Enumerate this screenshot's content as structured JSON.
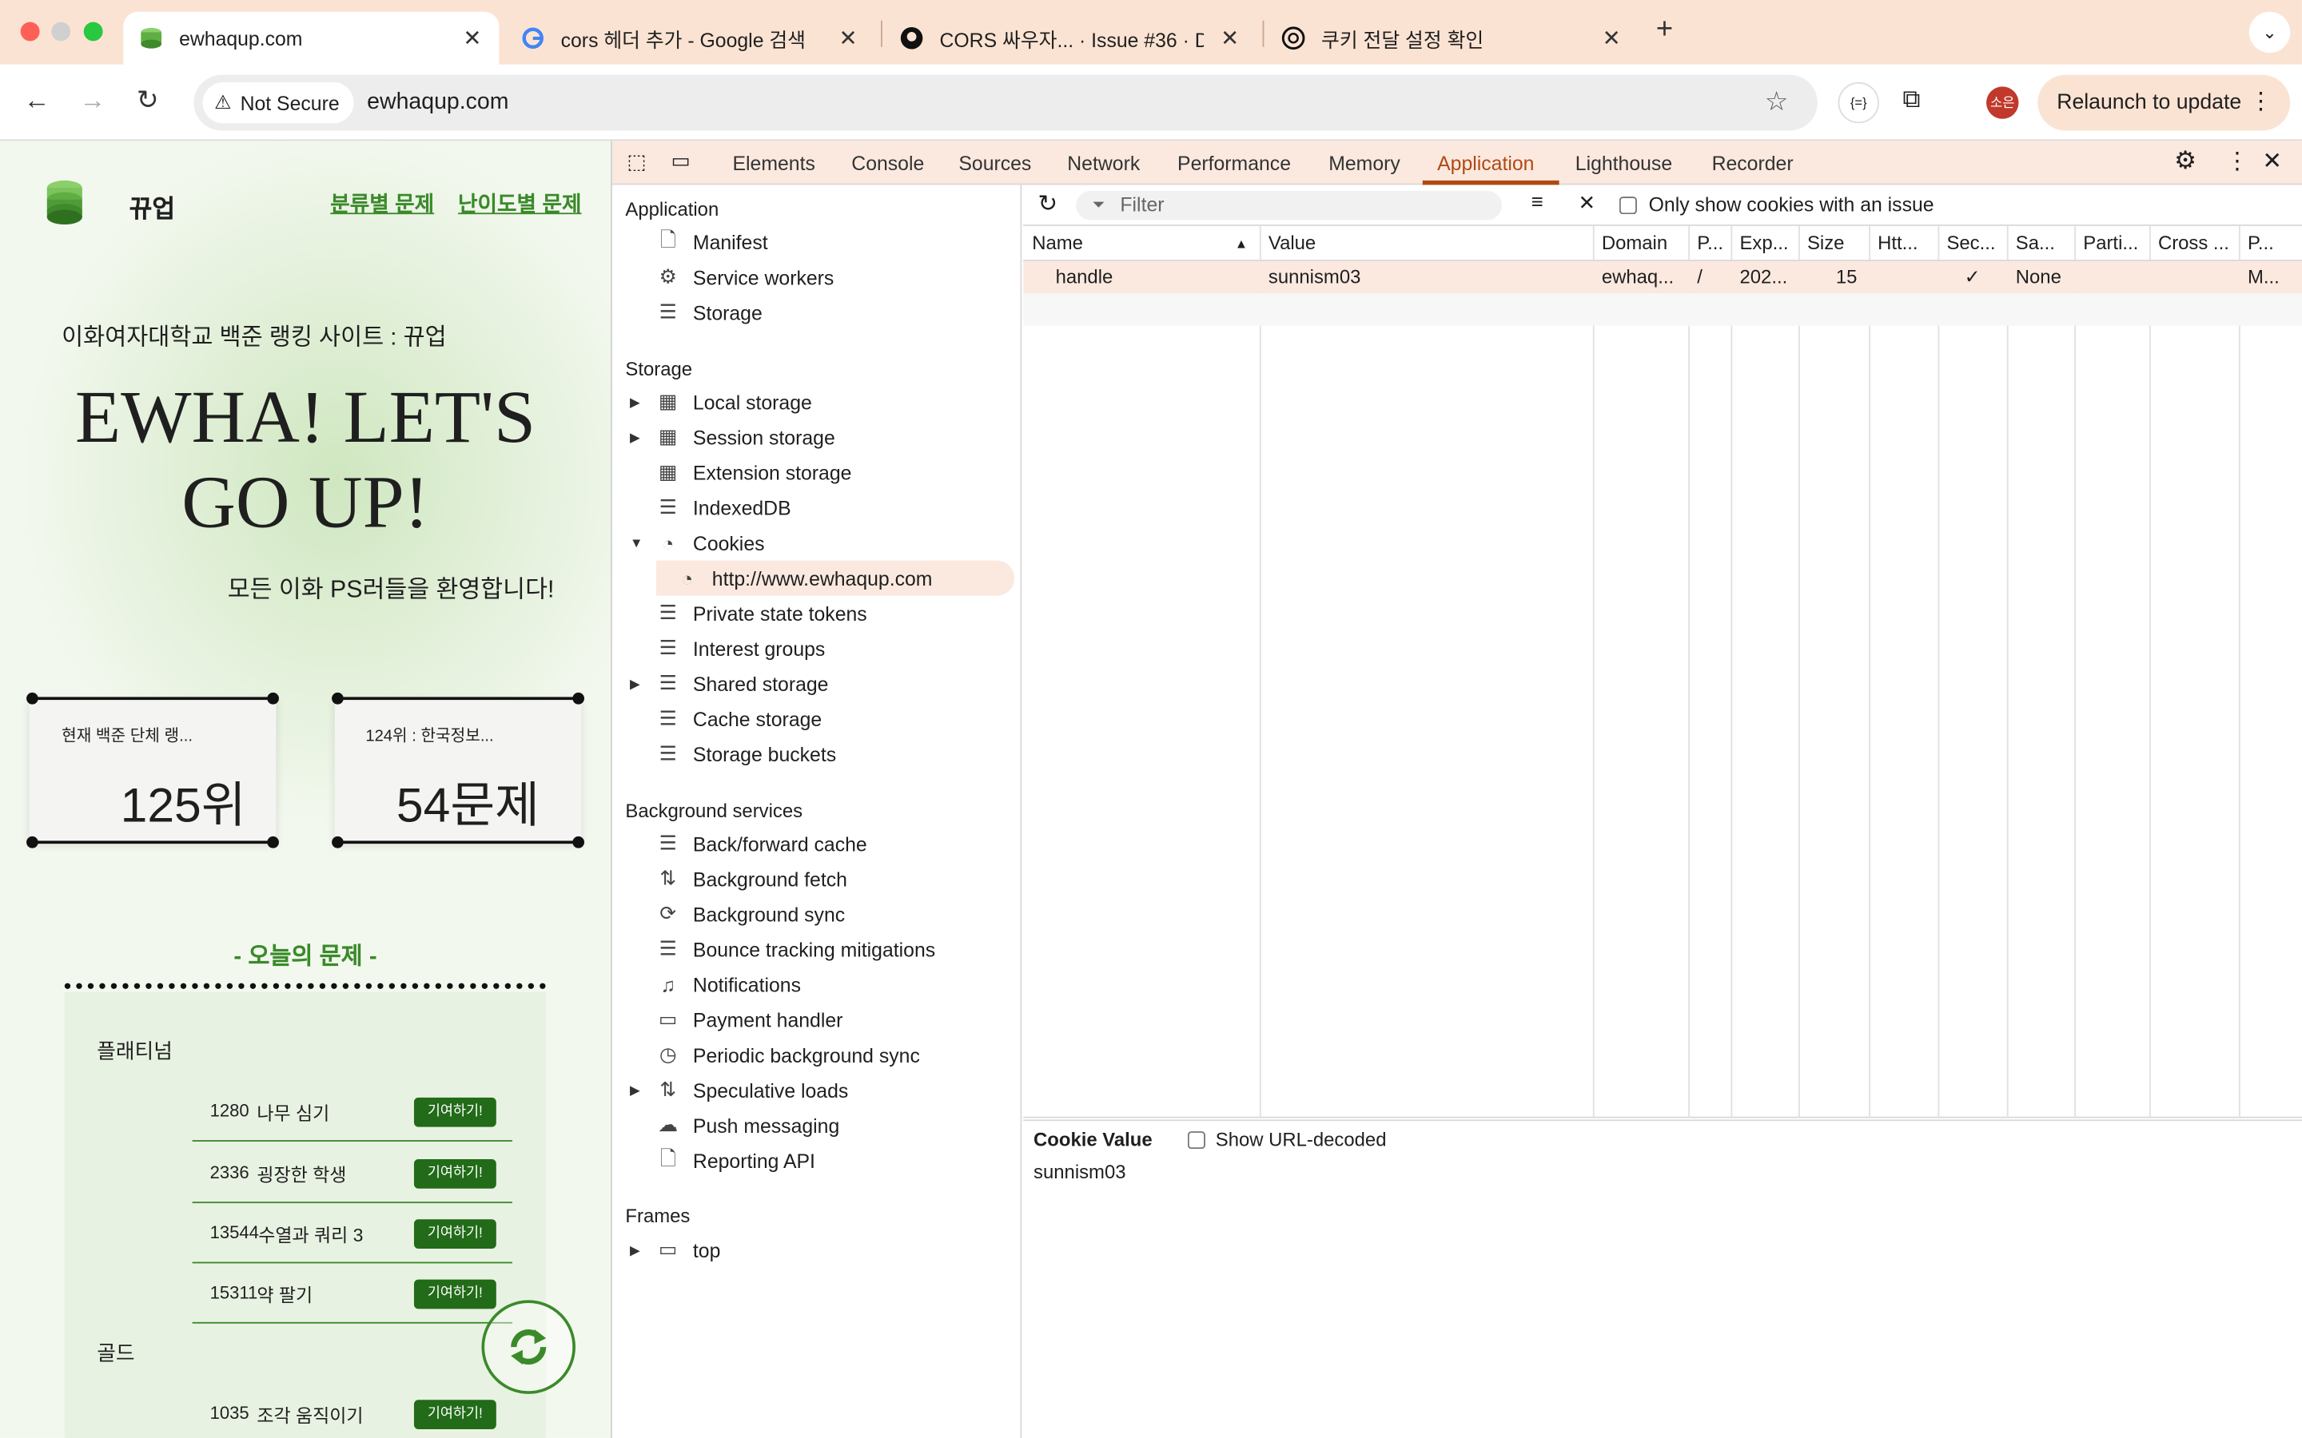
{
  "browser": {
    "tabs": [
      {
        "title": "ewhaqup.com",
        "active": true
      },
      {
        "title": "cors 헤더 추가 - Google 검색",
        "active": false
      },
      {
        "title": "CORS 싸우자... · Issue #36 · Da",
        "active": false
      },
      {
        "title": "쿠키 전달 설정 확인",
        "active": false
      }
    ],
    "security_label": "Not Secure",
    "url": "ewhaqup.com",
    "extension_label": "{=}",
    "profile_initials": "소은",
    "relaunch_label": "Relaunch to update"
  },
  "site": {
    "logo_text": "뀨업",
    "nav": [
      "분류별 문제",
      "난이도별 문제"
    ],
    "tagline": "이화여자대학교 백준 랭킹 사이트 : 뀨업",
    "hero_line1": "EWHA! LET'S",
    "hero_line2": "GO UP!",
    "welcome": "모든 이화 PS러들을 환영합니다!",
    "stat_cards": [
      {
        "caption": "현재 백준 단체 랭...",
        "value": "125위"
      },
      {
        "caption": "124위 : 한국정보...",
        "value": "54문제"
      }
    ],
    "today_title": "- 오늘의 문제 -",
    "tiers": [
      {
        "name": "플래티넘",
        "problems": [
          {
            "id": "1280",
            "name": "나무 심기"
          },
          {
            "id": "2336",
            "name": "굉장한 학생"
          },
          {
            "id": "13544",
            "name": "수열과 쿼리 3"
          },
          {
            "id": "15311",
            "name": "약 팔기"
          }
        ]
      },
      {
        "name": "골드",
        "problems": [
          {
            "id": "1035",
            "name": "조각 움직이기"
          }
        ]
      }
    ],
    "contribute_label": "기여하기!"
  },
  "devtools": {
    "tabs": [
      "Elements",
      "Console",
      "Sources",
      "Network",
      "Performance",
      "Memory",
      "Application",
      "Lighthouse",
      "Recorder"
    ],
    "active_tab": "Application",
    "sidebar": {
      "application_header": "Application",
      "application_items": [
        "Manifest",
        "Service workers",
        "Storage"
      ],
      "storage_header": "Storage",
      "storage_items": [
        "Local storage",
        "Session storage",
        "Extension storage",
        "IndexedDB",
        "Cookies",
        "http://www.ewhaqup.com",
        "Private state tokens",
        "Interest groups",
        "Shared storage",
        "Cache storage",
        "Storage buckets"
      ],
      "background_header": "Background services",
      "background_items": [
        "Back/forward cache",
        "Background fetch",
        "Background sync",
        "Bounce tracking mitigations",
        "Notifications",
        "Payment handler",
        "Periodic background sync",
        "Speculative loads",
        "Push messaging",
        "Reporting API"
      ],
      "frames_header": "Frames",
      "frames_items": [
        "top"
      ]
    },
    "filter_placeholder": "Filter",
    "only_issue_label": "Only show cookies with an issue",
    "columns": [
      "Name",
      "Value",
      "Domain",
      "P...",
      "Exp...",
      "Size",
      "Htt...",
      "Sec...",
      "Sa...",
      "Parti...",
      "Cross ...",
      "P..."
    ],
    "cookie_row": {
      "name": "handle",
      "value": "sunnism03",
      "domain": "ewhaq...",
      "path": "/",
      "expires": "202...",
      "size": "15",
      "secure": "✓",
      "samesite": "None",
      "priority": "M..."
    },
    "cookie_value_label": "Cookie Value",
    "show_decoded_label": "Show URL-decoded",
    "cookie_value": "sunnism03"
  }
}
